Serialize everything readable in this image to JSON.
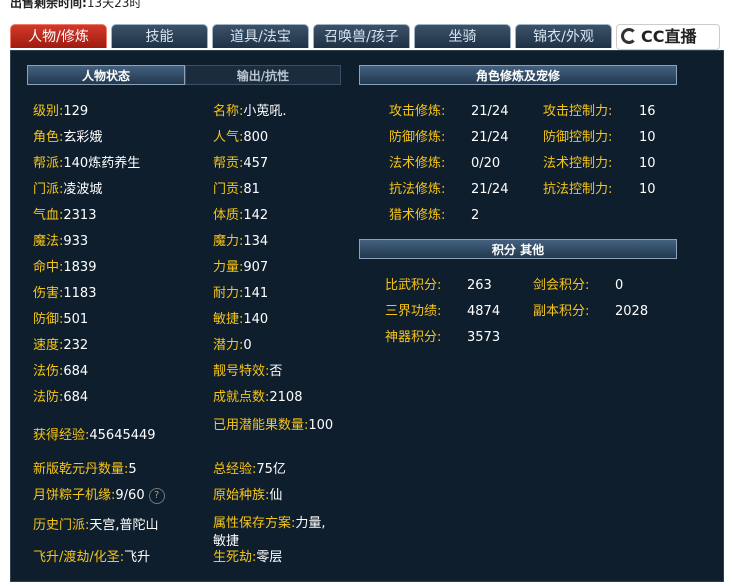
{
  "top_label": "出售剩余时间:",
  "top_value": "13天23时",
  "tabs": [
    {
      "label": "人物/修炼",
      "active": true
    },
    {
      "label": "技能"
    },
    {
      "label": "道具/法宝"
    },
    {
      "label": "召唤兽/孩子"
    },
    {
      "label": "坐骑"
    },
    {
      "label": "锦衣/外观"
    }
  ],
  "logo_text": "CC直播",
  "headers": {
    "status": "人物状态",
    "output": "输出/抗性",
    "cultivation": "角色修炼及宠修",
    "points": "积分 其他"
  },
  "left_col": [
    {
      "label": "级别:",
      "value": "129"
    },
    {
      "label": "角色:",
      "value": "玄彩娥"
    },
    {
      "label": "帮派:",
      "value": "140炼药养生"
    },
    {
      "label": "门派:",
      "value": "凌波城"
    },
    {
      "label": "气血:",
      "value": "2313"
    },
    {
      "label": "魔法:",
      "value": "933"
    },
    {
      "label": "命中:",
      "value": "1839"
    },
    {
      "label": "伤害:",
      "value": "1183"
    },
    {
      "label": "防御:",
      "value": "501"
    },
    {
      "label": "速度:",
      "value": "232"
    },
    {
      "label": "法伤:",
      "value": "684"
    },
    {
      "label": "法防:",
      "value": "684"
    },
    {
      "label": "获得经验:",
      "value": "45645449"
    },
    {
      "label": "新版乾元丹数量:",
      "value": "5"
    },
    {
      "label": "月饼粽子机缘:",
      "value": "9/60"
    },
    {
      "label": "历史门派:",
      "value": "天宫,普陀山"
    },
    {
      "label": "飞升/渡劫/化圣:",
      "value": "飞升"
    }
  ],
  "mid_col": [
    {
      "label": "名称:",
      "value": "小莵吼."
    },
    {
      "label": "人气:",
      "value": "800"
    },
    {
      "label": "帮贡:",
      "value": "457"
    },
    {
      "label": "门贡:",
      "value": "81"
    },
    {
      "label": "体质:",
      "value": "142"
    },
    {
      "label": "魔力:",
      "value": "134"
    },
    {
      "label": "力量:",
      "value": "907"
    },
    {
      "label": "耐力:",
      "value": "141"
    },
    {
      "label": "敏捷:",
      "value": "140"
    },
    {
      "label": "潜力:",
      "value": "0"
    },
    {
      "label": "靓号特效:",
      "value": "否"
    },
    {
      "label": "成就点数:",
      "value": "2108"
    },
    {
      "label": "已用潜能果数量:",
      "value": "100"
    },
    {
      "label": "总经验:",
      "value": "75亿"
    },
    {
      "label": "原始种族:",
      "value": "仙"
    },
    {
      "label": "属性保存方案:",
      "value": "力量,敏捷"
    },
    {
      "label": "生死劫:",
      "value": "零层"
    }
  ],
  "cult_left": [
    {
      "label": "攻击修炼:",
      "value": "21/24"
    },
    {
      "label": "防御修炼:",
      "value": "21/24"
    },
    {
      "label": "法术修炼:",
      "value": "0/20"
    },
    {
      "label": "抗法修炼:",
      "value": "21/24"
    },
    {
      "label": "猎术修炼:",
      "value": "2"
    }
  ],
  "cult_right": [
    {
      "label": "攻击控制力:",
      "value": "16"
    },
    {
      "label": "防御控制力:",
      "value": "10"
    },
    {
      "label": "法术控制力:",
      "value": "10"
    },
    {
      "label": "抗法控制力:",
      "value": "10"
    }
  ],
  "points_left": [
    {
      "label": "比武积分:",
      "value": "263"
    },
    {
      "label": "三界功绩:",
      "value": "4874"
    },
    {
      "label": "神器积分:",
      "value": "3573"
    }
  ],
  "points_right": [
    {
      "label": "剑会积分:",
      "value": "0"
    },
    {
      "label": "副本积分:",
      "value": "2028"
    }
  ],
  "help_glyph": "?",
  "colors": {
    "label": "#f5c518",
    "value": "#ffffff",
    "panel": "#0f1e2d",
    "active_tab": "#c0291c"
  }
}
